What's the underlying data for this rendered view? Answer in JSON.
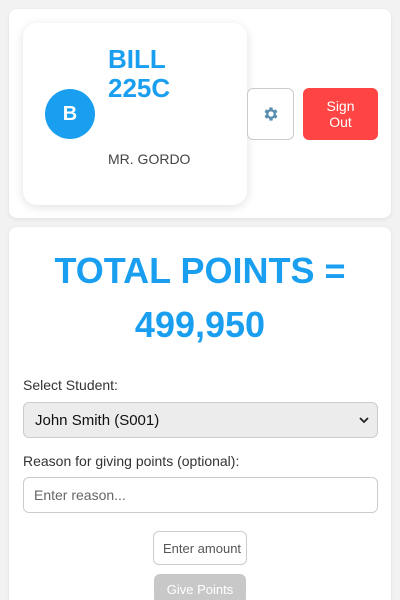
{
  "profile": {
    "avatar_initial": "B",
    "name_line1": "BILL",
    "name_line2": "225C",
    "teacher": "MR. GORDO"
  },
  "header": {
    "settings_icon": "gear-icon",
    "signout_label": "Sign Out"
  },
  "points": {
    "heading": "TOTAL POINTS =",
    "value": "499,950"
  },
  "form": {
    "student_label": "Select Student:",
    "student_selected": "John Smith (S001)",
    "reason_label": "Reason for giving points (optional):",
    "reason_placeholder": "Enter reason...",
    "amount_placeholder": "Enter amount",
    "give_label": "Give Points"
  },
  "colors": {
    "accent": "#1a9ff0",
    "danger": "#ff4444",
    "disabled": "#c8c8c8"
  }
}
